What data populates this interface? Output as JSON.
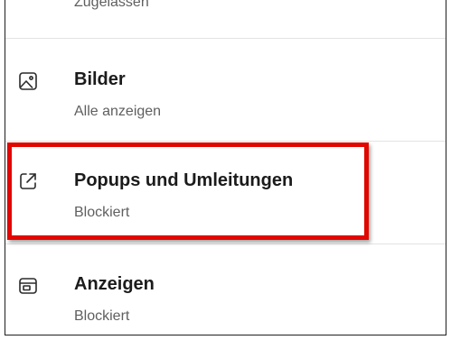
{
  "rows": [
    {
      "label": "",
      "status": "Zugelassen",
      "icon": ""
    },
    {
      "label": "Bilder",
      "status": "Alle anzeigen",
      "icon": "image-icon"
    },
    {
      "label": "Popups und Umleitungen",
      "status": "Blockiert",
      "icon": "external-link-icon"
    },
    {
      "label": "Anzeigen",
      "status": "Blockiert",
      "icon": "ad-window-icon"
    }
  ],
  "colors": {
    "highlight": "#e10600",
    "title_text": "#1b1b1b",
    "status_text": "#5f5f5f",
    "divider": "#e3e3e3"
  }
}
